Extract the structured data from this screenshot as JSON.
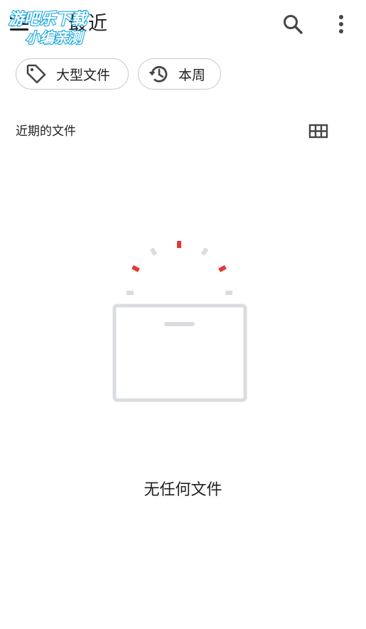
{
  "app_bar": {
    "title": "最近",
    "menu_icon": "hamburger-menu-icon",
    "search_icon": "search-icon",
    "more_icon": "more-vert-icon"
  },
  "watermark": {
    "line1": "游吧乐下载",
    "line2": "小编亲测",
    "colors": {
      "fill": "#ffffff",
      "stroke": "#19a8e0"
    }
  },
  "chips": [
    {
      "label": "大型文件",
      "icon": "tag-icon"
    },
    {
      "label": "本周",
      "icon": "history-icon"
    }
  ],
  "section": {
    "title": "近期的文件",
    "view_toggle_icon": "grid-view-icon"
  },
  "empty_state": {
    "message": "无任何文件",
    "illustration": "empty-box-illustration"
  },
  "colors": {
    "text": "#202124",
    "chip_border": "#c7c7c7",
    "illustration_gray": "#dadce0",
    "illustration_red": "#e53935"
  }
}
